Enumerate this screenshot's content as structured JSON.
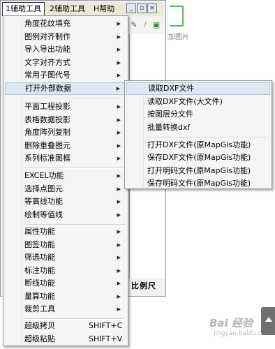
{
  "menubar": {
    "items": [
      {
        "label": "1辅助工具"
      },
      {
        "label": "2辅助工具"
      },
      {
        "label": "H帮助"
      }
    ]
  },
  "window_controls": {
    "minimize": "_",
    "restore": "▫",
    "close": "×"
  },
  "toolbar_icons": [
    "pen-icon",
    "brush-icon",
    "green-tool-icon"
  ],
  "picture_button": {
    "label": "加图片"
  },
  "scale_label": "比例尺",
  "main_menu": {
    "items": [
      {
        "label": "角度花纹填充",
        "has_submenu": true
      },
      {
        "label": "图例对齐制作",
        "has_submenu": true
      },
      {
        "label": "导入导出功能",
        "has_submenu": true
      },
      {
        "label": "文字对齐方式",
        "has_submenu": true
      },
      {
        "label": "常用子图代号",
        "has_submenu": true
      },
      {
        "label": "打开外部数据",
        "has_submenu": true,
        "highlighted": true
      },
      {
        "label": "平面工程投影",
        "has_submenu": true
      },
      {
        "label": "表格数据投影",
        "has_submenu": true
      },
      {
        "label": "角度阵列复制",
        "has_submenu": true
      },
      {
        "label": "删除重叠图元",
        "has_submenu": true
      },
      {
        "label": "系列标准图框",
        "has_submenu": true
      },
      {
        "label": "EXCEL功能",
        "has_submenu": true
      },
      {
        "label": "选择点图元",
        "has_submenu": true
      },
      {
        "label": "等高线功能",
        "has_submenu": true
      },
      {
        "label": "绘制等值线",
        "has_submenu": true
      },
      {
        "label": "属性功能",
        "has_submenu": true
      },
      {
        "label": "图签功能",
        "has_submenu": true
      },
      {
        "label": "筛选功能",
        "has_submenu": true
      },
      {
        "label": "标注功能",
        "has_submenu": true
      },
      {
        "label": "断线功能",
        "has_submenu": true
      },
      {
        "label": "量算功能",
        "has_submenu": true
      },
      {
        "label": "裁剪工具",
        "has_submenu": true
      },
      {
        "label": "超级拷贝",
        "shortcut": "SHIFT+C"
      },
      {
        "label": "超级粘贴",
        "shortcut": "SHIFT+V"
      }
    ]
  },
  "sub_menu": {
    "items": [
      {
        "label": "读取DXF文件",
        "highlighted": true
      },
      {
        "label": "读取DXF文件(大文件)"
      },
      {
        "label": "按图层分文件"
      },
      {
        "label": "批量转换dxf"
      },
      {
        "label": "打开DXF文件(原MapGis功能)"
      },
      {
        "label": "保存DXF文件(原MapGis功能)"
      },
      {
        "label": "打开明码文件(原MapGis功能)"
      },
      {
        "label": "保存明码文件(原MapGis功能)"
      }
    ]
  },
  "watermark": {
    "text": "Bai 经验",
    "sub": "jingyan.baidu.com"
  }
}
